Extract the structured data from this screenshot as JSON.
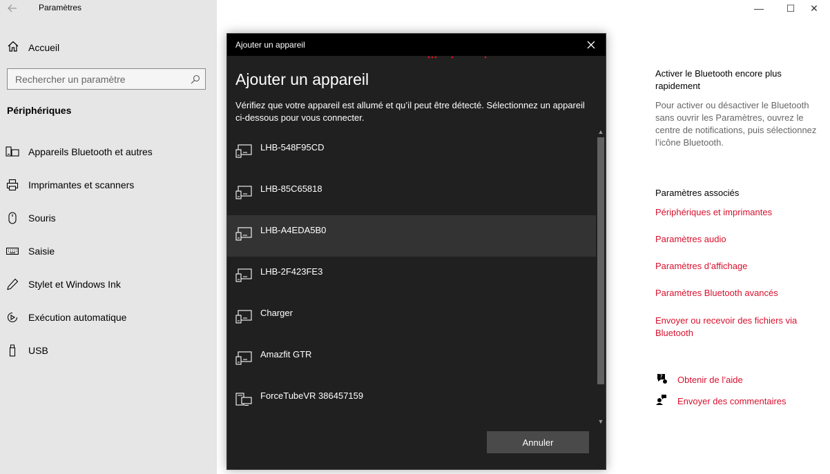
{
  "window": {
    "title": "Paramètres",
    "controls": {
      "minimize": "—",
      "maximize": "☐",
      "close": "✕"
    }
  },
  "sidebar": {
    "home_label": "Accueil",
    "search_placeholder": "Rechercher un paramètre",
    "section_title": "Périphériques",
    "items": [
      {
        "label": "Appareils Bluetooth et autres",
        "icon": "devices-icon"
      },
      {
        "label": "Imprimantes et scanners",
        "icon": "printer-icon"
      },
      {
        "label": "Souris",
        "icon": "mouse-icon"
      },
      {
        "label": "Saisie",
        "icon": "keyboard-icon"
      },
      {
        "label": "Stylet et Windows Ink",
        "icon": "pen-icon"
      },
      {
        "label": "Exécution automatique",
        "icon": "autoplay-icon"
      },
      {
        "label": "USB",
        "icon": "usb-icon"
      }
    ]
  },
  "right_panel": {
    "heading": "Activer le Bluetooth encore plus rapidement",
    "description": "Pour activer ou désactiver le Bluetooth sans ouvrir les Paramètres, ouvrez le centre de notifications, puis sélectionnez l’icône Bluetooth.",
    "related_title": "Paramètres associés",
    "links": [
      "Périphériques et imprimantes",
      "Paramètres audio",
      "Paramètres d’affichage",
      "Paramètres Bluetooth avancés",
      "Envoyer ou recevoir des fichiers via Bluetooth"
    ],
    "help_label": "Obtenir de l’aide",
    "feedback_label": "Envoyer des commentaires"
  },
  "dialog": {
    "title": "Ajouter un appareil",
    "heading": "Ajouter un appareil",
    "description": "Vérifiez que votre appareil est allumé et qu’il peut être détecté. Sélectionnez un appareil ci-dessous pour vous connecter.",
    "devices": [
      {
        "name": "LHB-548F95CD",
        "icon": "device-icon",
        "selected": false
      },
      {
        "name": "LHB-85C65818",
        "icon": "device-icon",
        "selected": false
      },
      {
        "name": "LHB-A4EDA5B0",
        "icon": "device-icon",
        "selected": true
      },
      {
        "name": "LHB-2F423FE3",
        "icon": "device-icon",
        "selected": false
      },
      {
        "name": "Charger",
        "icon": "device-icon",
        "selected": false
      },
      {
        "name": "Amazfit GTR",
        "icon": "device-icon",
        "selected": false
      },
      {
        "name": "ForceTubeVR 386457159",
        "icon": "computer-icon",
        "selected": false
      }
    ],
    "cancel_label": "Annuler"
  },
  "colors": {
    "accent_link": "#d80f2c",
    "sidebar_bg": "#e6e6e6",
    "dialog_bg": "#202020",
    "dialog_titlebar": "#000000",
    "selected_row": "#333333"
  }
}
